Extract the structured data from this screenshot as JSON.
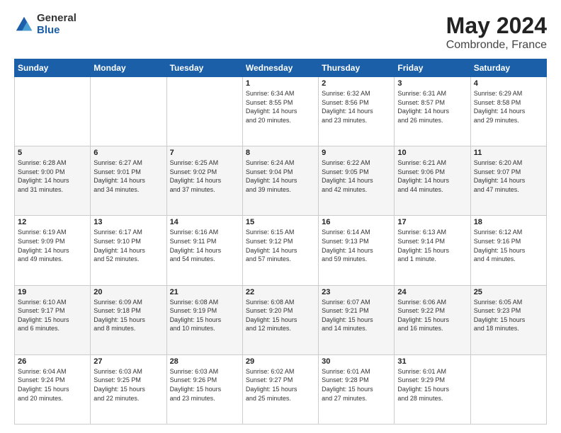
{
  "header": {
    "logo": {
      "general": "General",
      "blue": "Blue"
    },
    "title": "May 2024",
    "subtitle": "Combronde, France"
  },
  "calendar": {
    "days_of_week": [
      "Sunday",
      "Monday",
      "Tuesday",
      "Wednesday",
      "Thursday",
      "Friday",
      "Saturday"
    ],
    "weeks": [
      [
        {
          "day": "",
          "info": ""
        },
        {
          "day": "",
          "info": ""
        },
        {
          "day": "",
          "info": ""
        },
        {
          "day": "1",
          "info": "Sunrise: 6:34 AM\nSunset: 8:55 PM\nDaylight: 14 hours\nand 20 minutes."
        },
        {
          "day": "2",
          "info": "Sunrise: 6:32 AM\nSunset: 8:56 PM\nDaylight: 14 hours\nand 23 minutes."
        },
        {
          "day": "3",
          "info": "Sunrise: 6:31 AM\nSunset: 8:57 PM\nDaylight: 14 hours\nand 26 minutes."
        },
        {
          "day": "4",
          "info": "Sunrise: 6:29 AM\nSunset: 8:58 PM\nDaylight: 14 hours\nand 29 minutes."
        }
      ],
      [
        {
          "day": "5",
          "info": "Sunrise: 6:28 AM\nSunset: 9:00 PM\nDaylight: 14 hours\nand 31 minutes."
        },
        {
          "day": "6",
          "info": "Sunrise: 6:27 AM\nSunset: 9:01 PM\nDaylight: 14 hours\nand 34 minutes."
        },
        {
          "day": "7",
          "info": "Sunrise: 6:25 AM\nSunset: 9:02 PM\nDaylight: 14 hours\nand 37 minutes."
        },
        {
          "day": "8",
          "info": "Sunrise: 6:24 AM\nSunset: 9:04 PM\nDaylight: 14 hours\nand 39 minutes."
        },
        {
          "day": "9",
          "info": "Sunrise: 6:22 AM\nSunset: 9:05 PM\nDaylight: 14 hours\nand 42 minutes."
        },
        {
          "day": "10",
          "info": "Sunrise: 6:21 AM\nSunset: 9:06 PM\nDaylight: 14 hours\nand 44 minutes."
        },
        {
          "day": "11",
          "info": "Sunrise: 6:20 AM\nSunset: 9:07 PM\nDaylight: 14 hours\nand 47 minutes."
        }
      ],
      [
        {
          "day": "12",
          "info": "Sunrise: 6:19 AM\nSunset: 9:09 PM\nDaylight: 14 hours\nand 49 minutes."
        },
        {
          "day": "13",
          "info": "Sunrise: 6:17 AM\nSunset: 9:10 PM\nDaylight: 14 hours\nand 52 minutes."
        },
        {
          "day": "14",
          "info": "Sunrise: 6:16 AM\nSunset: 9:11 PM\nDaylight: 14 hours\nand 54 minutes."
        },
        {
          "day": "15",
          "info": "Sunrise: 6:15 AM\nSunset: 9:12 PM\nDaylight: 14 hours\nand 57 minutes."
        },
        {
          "day": "16",
          "info": "Sunrise: 6:14 AM\nSunset: 9:13 PM\nDaylight: 14 hours\nand 59 minutes."
        },
        {
          "day": "17",
          "info": "Sunrise: 6:13 AM\nSunset: 9:14 PM\nDaylight: 15 hours\nand 1 minute."
        },
        {
          "day": "18",
          "info": "Sunrise: 6:12 AM\nSunset: 9:16 PM\nDaylight: 15 hours\nand 4 minutes."
        }
      ],
      [
        {
          "day": "19",
          "info": "Sunrise: 6:10 AM\nSunset: 9:17 PM\nDaylight: 15 hours\nand 6 minutes."
        },
        {
          "day": "20",
          "info": "Sunrise: 6:09 AM\nSunset: 9:18 PM\nDaylight: 15 hours\nand 8 minutes."
        },
        {
          "day": "21",
          "info": "Sunrise: 6:08 AM\nSunset: 9:19 PM\nDaylight: 15 hours\nand 10 minutes."
        },
        {
          "day": "22",
          "info": "Sunrise: 6:08 AM\nSunset: 9:20 PM\nDaylight: 15 hours\nand 12 minutes."
        },
        {
          "day": "23",
          "info": "Sunrise: 6:07 AM\nSunset: 9:21 PM\nDaylight: 15 hours\nand 14 minutes."
        },
        {
          "day": "24",
          "info": "Sunrise: 6:06 AM\nSunset: 9:22 PM\nDaylight: 15 hours\nand 16 minutes."
        },
        {
          "day": "25",
          "info": "Sunrise: 6:05 AM\nSunset: 9:23 PM\nDaylight: 15 hours\nand 18 minutes."
        }
      ],
      [
        {
          "day": "26",
          "info": "Sunrise: 6:04 AM\nSunset: 9:24 PM\nDaylight: 15 hours\nand 20 minutes."
        },
        {
          "day": "27",
          "info": "Sunrise: 6:03 AM\nSunset: 9:25 PM\nDaylight: 15 hours\nand 22 minutes."
        },
        {
          "day": "28",
          "info": "Sunrise: 6:03 AM\nSunset: 9:26 PM\nDaylight: 15 hours\nand 23 minutes."
        },
        {
          "day": "29",
          "info": "Sunrise: 6:02 AM\nSunset: 9:27 PM\nDaylight: 15 hours\nand 25 minutes."
        },
        {
          "day": "30",
          "info": "Sunrise: 6:01 AM\nSunset: 9:28 PM\nDaylight: 15 hours\nand 27 minutes."
        },
        {
          "day": "31",
          "info": "Sunrise: 6:01 AM\nSunset: 9:29 PM\nDaylight: 15 hours\nand 28 minutes."
        },
        {
          "day": "",
          "info": ""
        }
      ]
    ]
  }
}
